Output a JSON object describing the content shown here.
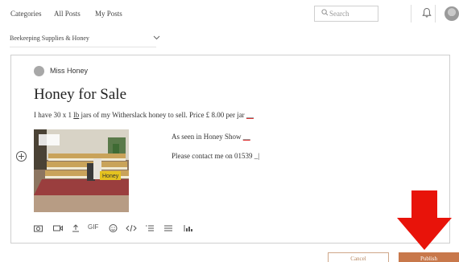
{
  "nav": {
    "links": [
      "Categories",
      "All Posts",
      "My Posts"
    ],
    "search_placeholder": "Search",
    "icons": [
      "search-icon",
      "bell-icon",
      "avatar"
    ]
  },
  "category": {
    "selected": "Beekeeping Supplies & Honey",
    "icon": "chevron-down-icon"
  },
  "post": {
    "author": "Miss Honey",
    "title": "Honey for Sale",
    "line1": {
      "a": "I have 30 x 1 ",
      "unit": "lb",
      "b": "  jars of  my Witherslack honey to sell. Price £ 8.00 per jar "
    },
    "side_text_1": "As seen in Honey Show ",
    "side_text_2": "Please contact me on 01539 ",
    "image_sign": "Honey"
  },
  "toolbar": {
    "gif_label": "GIF",
    "icons": [
      "camera-icon",
      "video-icon",
      "upload-icon",
      "gif-icon",
      "emoji-icon",
      "code-icon",
      "list-icon",
      "align-icon",
      "chart-icon"
    ]
  },
  "buttons": {
    "cancel": "Cancel",
    "publish": "Publish"
  },
  "colors": {
    "accent": "#c8784b",
    "arrow": "#e8130a"
  }
}
